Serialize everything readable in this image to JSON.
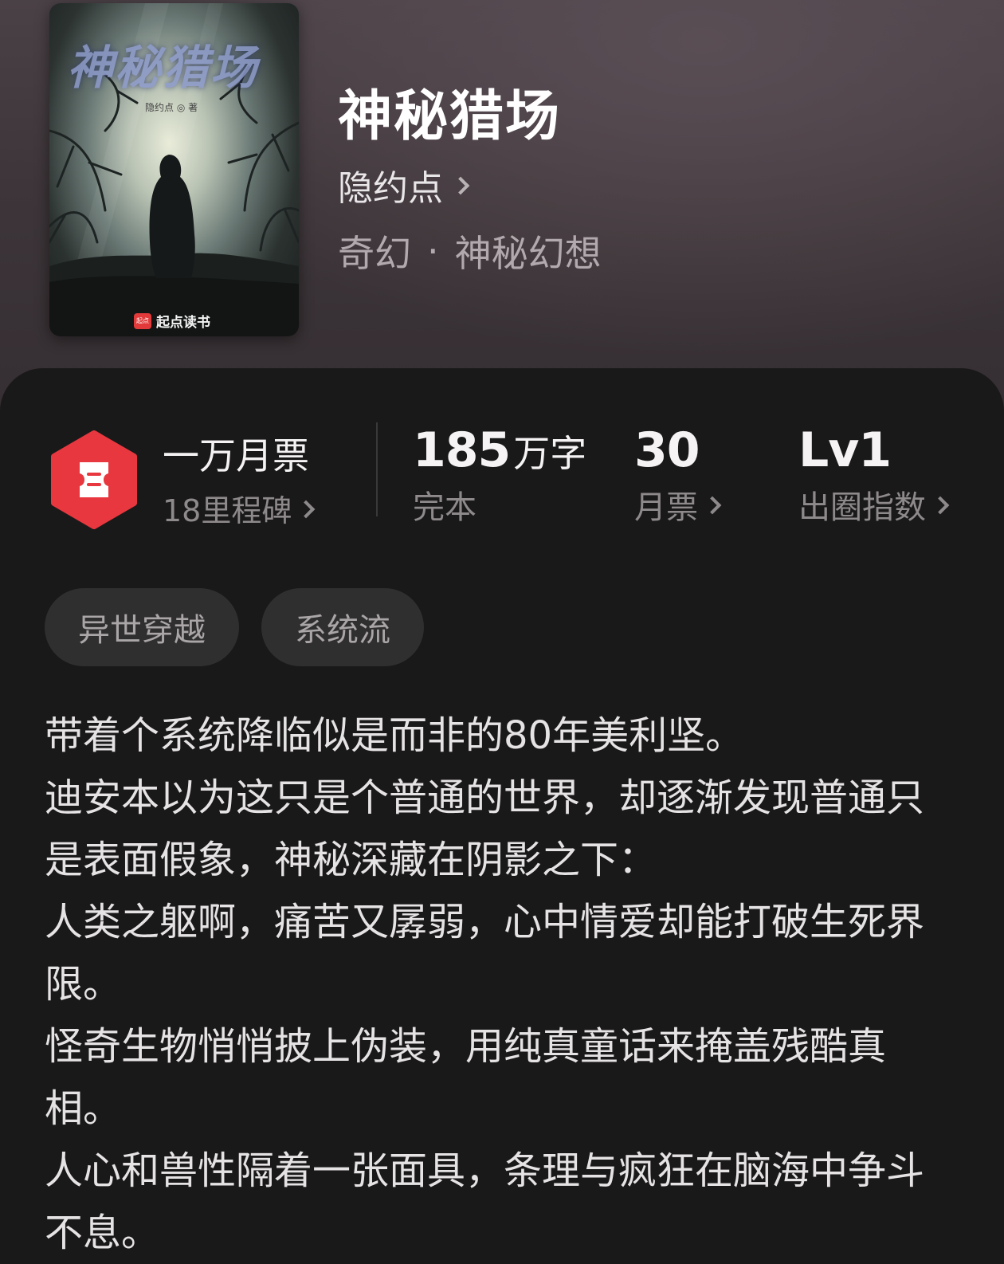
{
  "book": {
    "title": "神秘猎场",
    "author": "隐约点",
    "genre_primary": "奇幻",
    "genre_separator": "·",
    "genre_secondary": "神秘幻想"
  },
  "cover": {
    "title_text": "神秘猎场",
    "author_text": "隐约点 ◎ 著",
    "logo_mark": "起点",
    "logo_text": "起点读书"
  },
  "milestone": {
    "title": "一万月票",
    "subtitle": "18里程碑",
    "icon": "ticket-hexagon-icon",
    "color": "#e8373f"
  },
  "stats": {
    "word_count": "185",
    "word_unit": "万字",
    "word_label": "完本",
    "monthly_votes": "30",
    "monthly_votes_label": "月票",
    "level": "Lv1",
    "level_label": "出圈指数"
  },
  "tags": [
    {
      "label": "异世穿越"
    },
    {
      "label": "系统流"
    }
  ],
  "synopsis": [
    "带着个系统降临似是而非的80年美利坚。",
    "迪安本以为这只是个普通的世界，却逐渐发现普通只是表面假象，神秘深藏在阴影之下：",
    "人类之躯啊，痛苦又孱弱，心中情爱却能打破生死界限。",
    "怪奇生物悄悄披上伪装，用纯真童话来掩盖残酷真相。",
    "人心和兽性隔着一张面具，条理与疯狂在脑海中争斗不息。"
  ]
}
